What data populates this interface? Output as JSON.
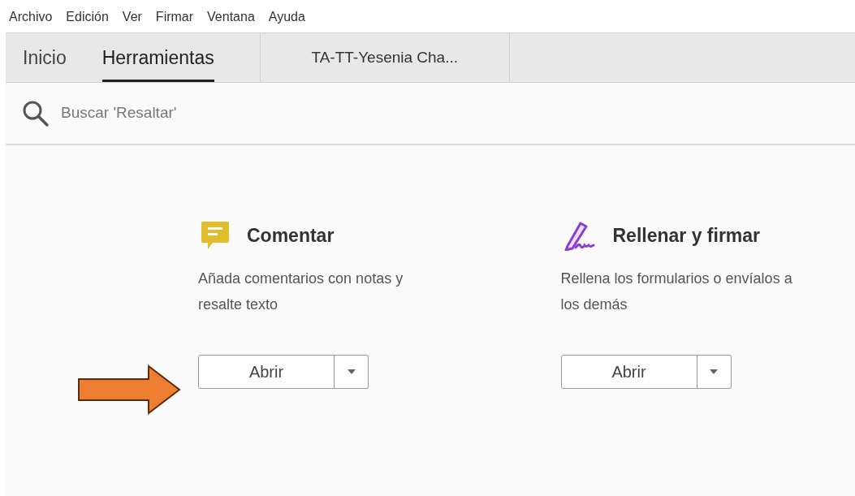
{
  "menu_bar": [
    "Archivo",
    "Edición",
    "Ver",
    "Firmar",
    "Ventana",
    "Ayuda"
  ],
  "tabs": [
    {
      "label": "Inicio",
      "selected": false
    },
    {
      "label": "Herramientas",
      "selected": true
    }
  ],
  "document_tab": {
    "label": "TA-TT-Yesenia Cha..."
  },
  "search": {
    "placeholder": "Buscar 'Resaltar'"
  },
  "tools": [
    {
      "kind": "comment",
      "title": "Comentar",
      "description": "Añada comentarios con notas y resalte texto",
      "button": "Abrir"
    },
    {
      "kind": "sign",
      "title": "Rellenar y firmar",
      "description": "Rellena los formularios o envíalos a los demás",
      "button": "Abrir"
    }
  ]
}
